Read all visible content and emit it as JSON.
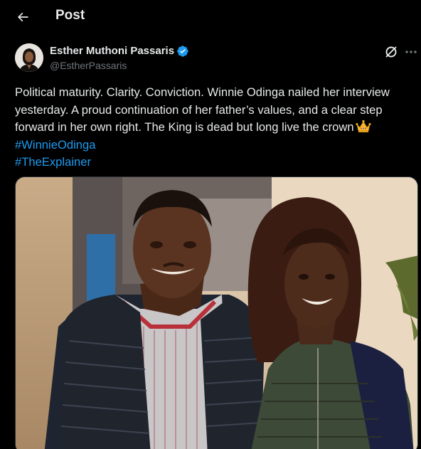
{
  "header": {
    "title": "Post",
    "back_icon": "arrow-left-icon"
  },
  "author": {
    "name": "Esther Muthoni Passaris",
    "handle": "@EstherPassaris",
    "verified_icon": "verified-badge-icon",
    "verified_color": "#1d9bf0"
  },
  "actions": {
    "grok_icon": "grok-icon",
    "more_icon": "more-horizontal-icon"
  },
  "post": {
    "text_lines": [
      "Political maturity. Clarity. Conviction. Winnie Odinga nailed her interview",
      "yesterday. A proud continuation of her father’s values, and a clear step",
      "forward in her own right. The King is dead but long live the crown"
    ],
    "emoji_icon": "crown-emoji-icon",
    "hashtags": [
      "#WinnieOdinga",
      "#TheExplainer"
    ],
    "link_color": "#1d9bf0"
  },
  "media": {
    "type": "photo",
    "icon": "photo-two-people-icon"
  },
  "colors": {
    "background": "#000000",
    "text": "#e7e9ea",
    "secondary": "#71767b"
  }
}
